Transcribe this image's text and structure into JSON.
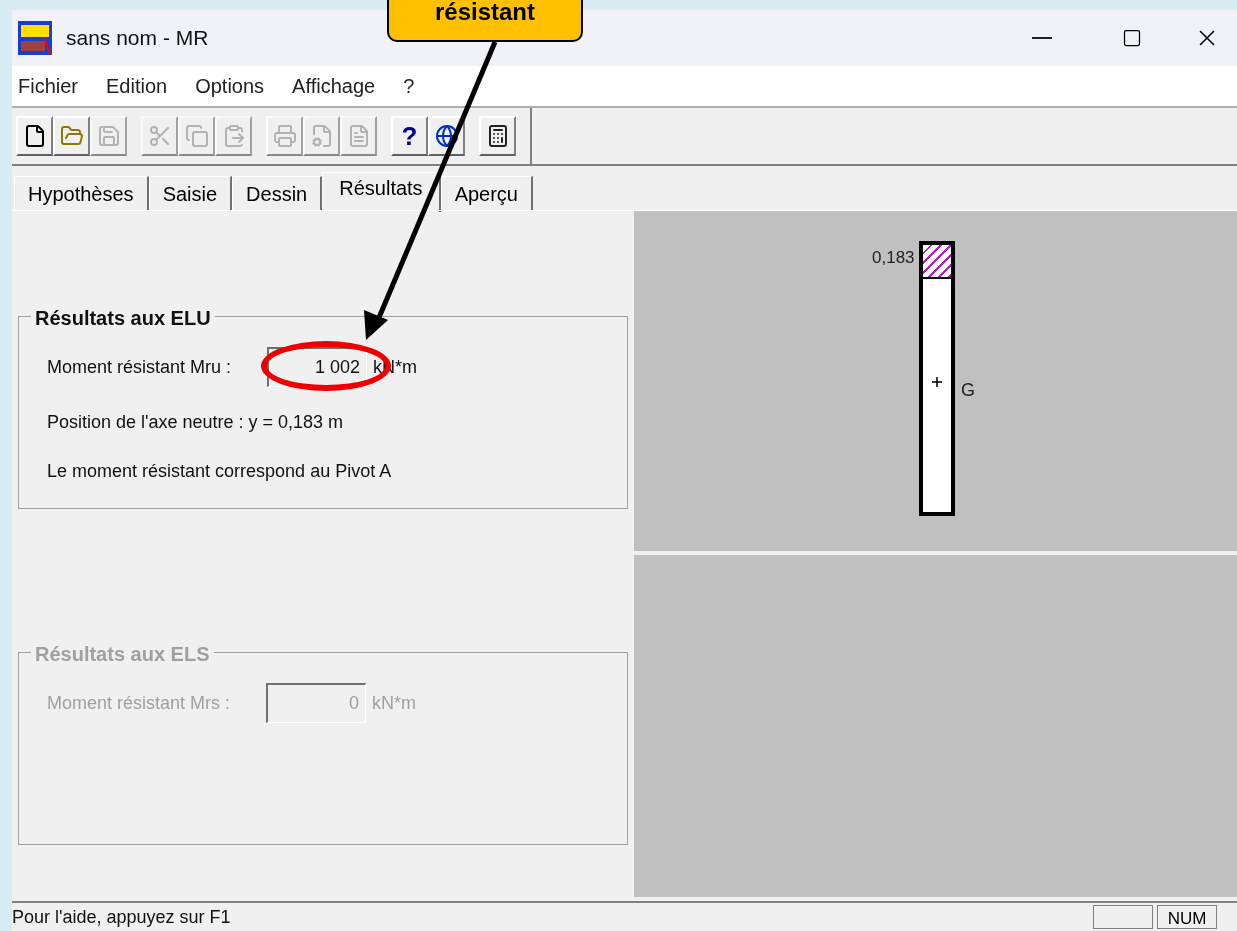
{
  "callout": {
    "text": "résistant"
  },
  "window": {
    "title": "sans nom - MR"
  },
  "menu": [
    {
      "label": "Fichier"
    },
    {
      "label": "Edition"
    },
    {
      "label": "Options"
    },
    {
      "label": "Affichage"
    },
    {
      "label": "?"
    }
  ],
  "toolbar": [
    [
      {
        "disabled": false
      },
      {
        "disabled": false
      },
      {
        "disabled": true
      }
    ],
    [
      {
        "disabled": true
      },
      {
        "disabled": true
      },
      {
        "disabled": true
      }
    ],
    [
      {
        "disabled": true
      },
      {
        "disabled": true
      },
      {
        "disabled": true
      }
    ],
    [
      {
        "disabled": false,
        "label": "?"
      },
      {
        "disabled": false
      }
    ],
    [
      {
        "disabled": false
      }
    ]
  ],
  "tabs": [
    {
      "label": "Hypothèses",
      "selected": false
    },
    {
      "label": "Saisie",
      "selected": false
    },
    {
      "label": "Dessin",
      "selected": false
    },
    {
      "label": "Résultats",
      "selected": true
    },
    {
      "label": "Aperçu",
      "selected": false
    }
  ],
  "groups": [
    {
      "title": "Résultats aux ELU",
      "disabled": false,
      "field_label": "Moment résistant Mru :",
      "value": "1 002",
      "unit": "kN*m",
      "highlighted": true,
      "lines": [
        "Position de l'axe neutre : y = 0,183 m",
        "Le moment résistant correspond au Pivot A"
      ]
    },
    {
      "title": "Résultats aux ELS",
      "disabled": true,
      "field_label": "Moment résistant Mrs :",
      "value": "0",
      "unit": "kN*m",
      "highlighted": false
    }
  ],
  "drawing": {
    "depth_label": "0,183",
    "centroid_label": "G"
  },
  "status_bar": {
    "text": "Pour l'aide, appuyez sur F1",
    "indicators": [
      "NUM"
    ]
  }
}
